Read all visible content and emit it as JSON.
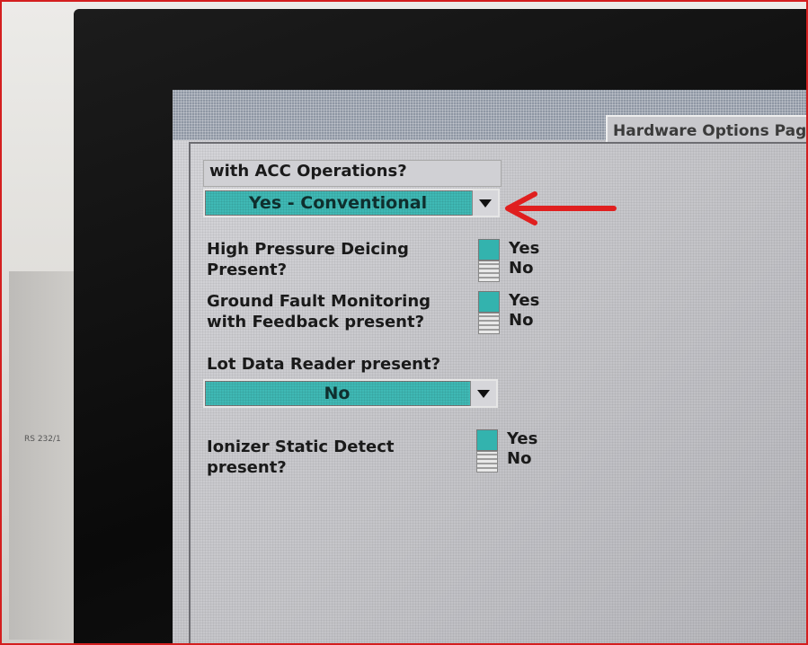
{
  "window": {
    "page_title": "Hardware Options Page"
  },
  "background": {
    "device_label": "RS 232/1"
  },
  "fields": {
    "acc": {
      "label": "with ACC Operations?",
      "value": "Yes - Conventional"
    },
    "high_pressure": {
      "label_line1": "High Pressure Deicing",
      "label_line2": "Present?",
      "yes": "Yes",
      "no": "No"
    },
    "ground_fault": {
      "label_line1": "Ground Fault Monitoring",
      "label_line2": "with Feedback present?",
      "yes": "Yes",
      "no": "No"
    },
    "lot_data": {
      "label": "Lot Data Reader present?",
      "value": "No"
    },
    "ionizer": {
      "label_line1": "Ionizer Static Detect",
      "label_line2": "present?",
      "yes": "Yes",
      "no": "No"
    }
  },
  "colors": {
    "accent_teal": "#3fb9b5",
    "annotation_red": "#e01f1f",
    "frame_red": "#d41f1f"
  },
  "icons": {
    "dropdown_arrow": "chevron-down-icon",
    "annotation": "red-arrow-icon"
  }
}
